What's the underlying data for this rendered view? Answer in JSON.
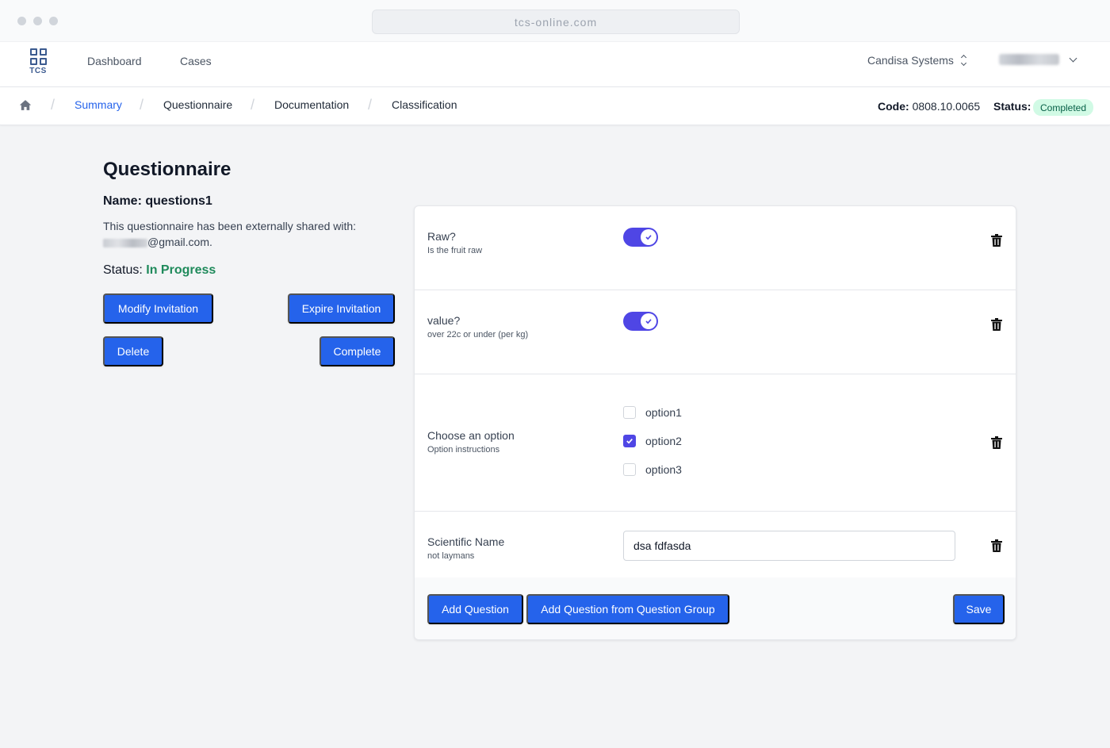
{
  "browser": {
    "url": "tcs-online.com"
  },
  "nav": {
    "logo_text": "TCS",
    "links": [
      "Dashboard",
      "Cases"
    ],
    "org": "Candisa Systems"
  },
  "breadcrumb": {
    "items": [
      "Summary",
      "Questionnaire",
      "Documentation",
      "Classification"
    ],
    "code_label": "Code:",
    "code_value": "0808.10.0065",
    "status_label": "Status:",
    "status_value": "Completed"
  },
  "left": {
    "title": "Questionnaire",
    "name": "Name: questions1",
    "shared_text": "This questionnaire has been externally shared with:",
    "email_suffix": "@gmail.com.",
    "status_label": "Status:",
    "status_value": "In Progress",
    "buttons": {
      "modify": "Modify Invitation",
      "expire": "Expire Invitation",
      "delete": "Delete",
      "complete": "Complete"
    }
  },
  "questions": [
    {
      "label": "Raw?",
      "sub": "Is the fruit raw",
      "type": "toggle",
      "value": true
    },
    {
      "label": "value?",
      "sub": "over 22c or under (per kg)",
      "type": "toggle",
      "value": true
    },
    {
      "label": "Choose an option",
      "sub": "Option instructions",
      "type": "checkbox",
      "options": [
        {
          "label": "option1",
          "checked": false
        },
        {
          "label": "option2",
          "checked": true
        },
        {
          "label": "option3",
          "checked": false
        }
      ]
    },
    {
      "label": "Scientific Name",
      "sub": "not laymans",
      "type": "text",
      "value": "dsa fdfasda"
    }
  ],
  "footer": {
    "add_question": "Add Question",
    "add_from_group": "Add Question from Question Group",
    "save": "Save"
  },
  "colors": {
    "primary": "#2563eb",
    "toggle": "#4f46e5",
    "status_green": "#1f8a5b",
    "badge_bg": "#d1fae5"
  }
}
